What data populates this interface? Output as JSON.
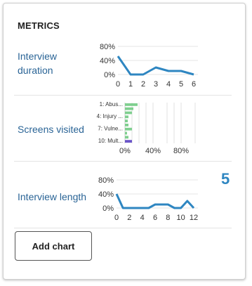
{
  "header": {
    "title": "METRICS"
  },
  "metrics": [
    {
      "label": "Interview duration"
    },
    {
      "label": "Screens visited"
    },
    {
      "label": "Interview length",
      "value": "5"
    }
  ],
  "actions": {
    "add_chart_label": "Add chart"
  },
  "colors": {
    "line": "#2e86c1",
    "bar_green": "#7fcf8f",
    "bar_purple": "#6a55c8",
    "link": "#2a6496"
  },
  "chart_data": [
    {
      "type": "line",
      "x": [
        0,
        1,
        2,
        3,
        4,
        5,
        6
      ],
      "series": [
        {
          "values": [
            52,
            0,
            0,
            20,
            10,
            10,
            0
          ]
        }
      ],
      "y_ticks": [
        "80%",
        "40%",
        "0%"
      ],
      "x_ticks": [
        "0",
        "1",
        "2",
        "3",
        "4",
        "5",
        "6"
      ],
      "ylim": [
        0,
        80
      ],
      "xlim": [
        0,
        6
      ],
      "grid": true
    },
    {
      "type": "bar",
      "orientation": "horizontal",
      "categories": [
        "1: Abus...",
        "",
        "",
        "4: Injury ...",
        "",
        "",
        "7: Vulne...",
        "",
        "",
        "10: Mult..."
      ],
      "values": [
        18,
        12,
        10,
        5,
        4,
        5,
        10,
        3,
        5,
        10
      ],
      "highlight_index": 9,
      "x_ticks": [
        "0%",
        "40%",
        "80%"
      ],
      "xlim": [
        0,
        100
      ],
      "grid": true
    },
    {
      "type": "line",
      "x": [
        0,
        1,
        2,
        3,
        4,
        5,
        6,
        7,
        8,
        9,
        10,
        11,
        12
      ],
      "series": [
        {
          "values": [
            40,
            0,
            0,
            0,
            0,
            0,
            10,
            10,
            10,
            0,
            0,
            20,
            0
          ]
        }
      ],
      "y_ticks": [
        "80%",
        "40%",
        "0%"
      ],
      "x_ticks": [
        "0",
        "2",
        "4",
        "6",
        "8",
        "10",
        "12"
      ],
      "ylim": [
        0,
        80
      ],
      "xlim": [
        0,
        12
      ],
      "grid": true
    }
  ]
}
